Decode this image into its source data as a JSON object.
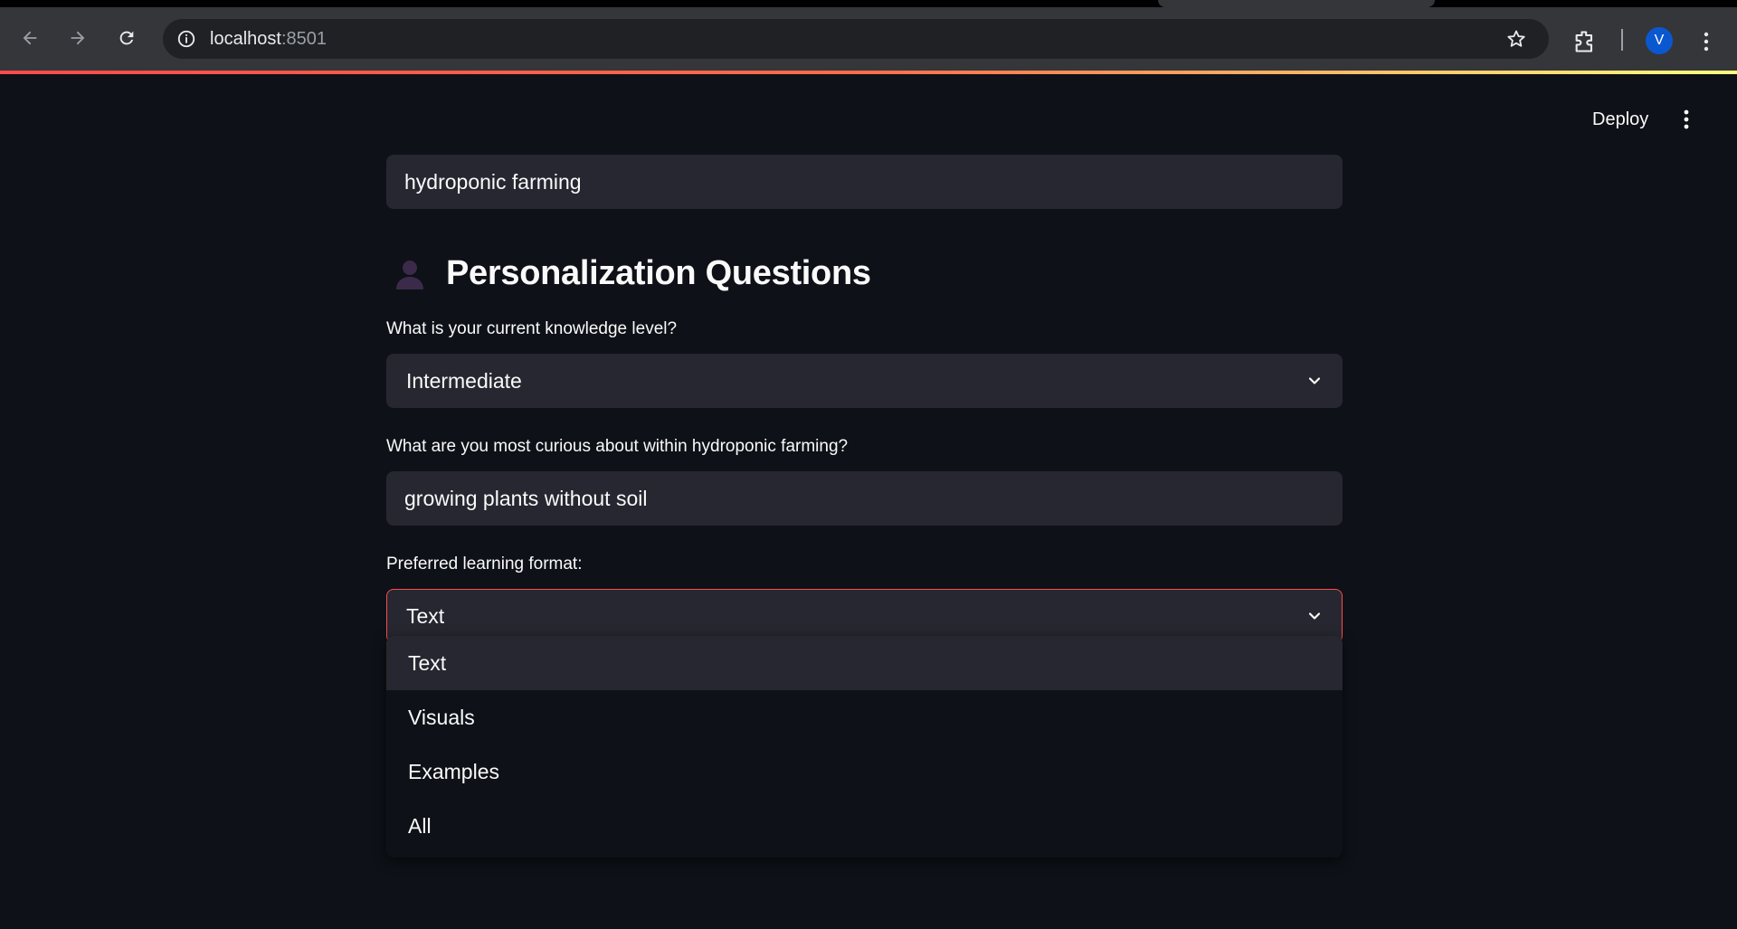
{
  "browser": {
    "url_host": "localhost",
    "url_port": ":8501",
    "profile_initial": "V"
  },
  "app_header": {
    "deploy_label": "Deploy"
  },
  "main": {
    "topic_value": "hydroponic farming",
    "heading": "Personalization Questions",
    "knowledge": {
      "label": "What is your current knowledge level?",
      "value": "Intermediate"
    },
    "curiosity": {
      "label": "What are you most curious about within hydroponic farming?",
      "value": "growing plants without soil"
    },
    "format": {
      "label": "Preferred learning format:",
      "value": "Text",
      "options": [
        "Text",
        "Visuals",
        "Examples",
        "All"
      ]
    }
  },
  "colors": {
    "background": "#0e1117",
    "input_bg": "#262730",
    "accent": "#ff4b4b",
    "avatar": "#0b57d0"
  },
  "icons": [
    "back-arrow-icon",
    "forward-arrow-icon",
    "reload-icon",
    "info-icon",
    "star-icon",
    "extensions-icon",
    "kebab-menu-icon",
    "person-emoji-icon",
    "chevron-down-icon"
  ]
}
